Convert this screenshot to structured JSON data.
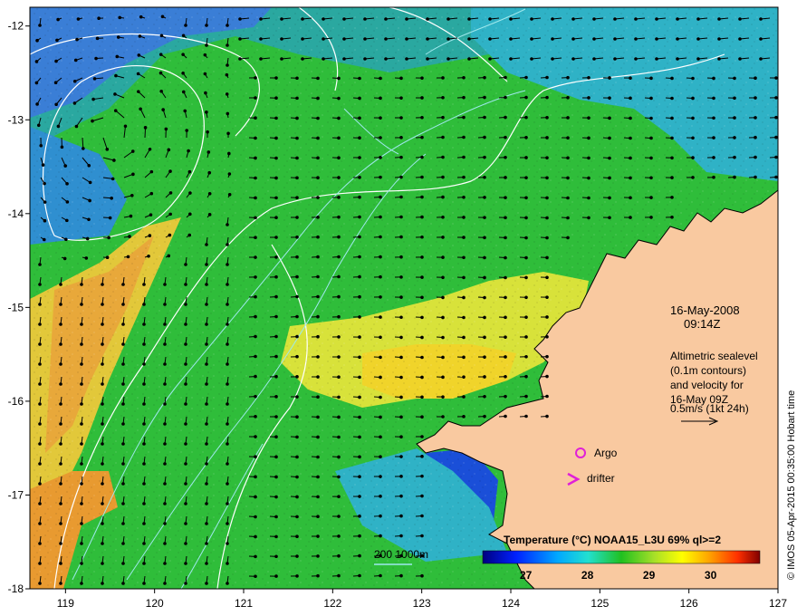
{
  "map": {
    "lon_range": [
      118.6,
      127
    ],
    "lat_range": [
      -18,
      -11.8
    ],
    "lon_ticks": [
      "119",
      "120",
      "121",
      "122",
      "123",
      "124",
      "125",
      "126",
      "127"
    ],
    "lat_ticks": [
      "-12",
      "-13",
      "-14",
      "-15",
      "-16",
      "-17",
      "-18"
    ],
    "date_line1": "16-May-2008",
    "date_line2": "09:14Z",
    "legend_lines": [
      "Altimetric sealevel",
      "(0.1m contours)",
      "and velocity for",
      "16-May 09Z",
      "0.5m/s (1kt 24h)"
    ],
    "argo_label": "Argo",
    "drifter_label": "drifter",
    "bathymetry_label": "200  1000m",
    "colorbar": {
      "title": "Temperature (°C) NOAA15_L3U 69% ql>=2",
      "range": [
        26.3,
        30.8
      ],
      "tick_labels": [
        "27",
        "28",
        "29",
        "30"
      ]
    },
    "credit": "© IMOS 05-Apr-2015 00:35:00 Hobart time",
    "colors": {
      "land": "#f9c9a0",
      "sst_cold": "#1a4fd8",
      "sst_mid": "#2fbd3a",
      "sst_warm": "#f5d22a",
      "sst_hot": "#e8862a",
      "argo": "#e01fd8",
      "contour": "#ffffff",
      "bathy": "#9ee8ec"
    }
  }
}
